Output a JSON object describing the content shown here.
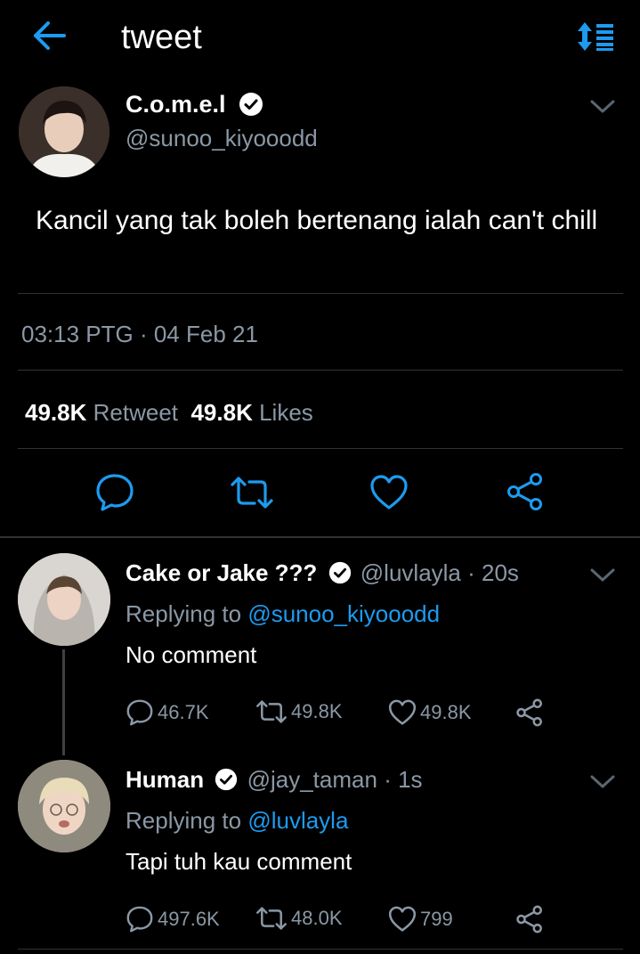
{
  "header": {
    "title": "tweet",
    "back_icon": "arrow-left-icon",
    "sort_icon": "sort-icon",
    "accent": "#1d9bf0"
  },
  "main_tweet": {
    "display_name": "C.o.m.e.l",
    "handle": "@sunoo_kiyooodd",
    "text": "Kancil yang tak boleh bertenang ialah can't chill",
    "timestamp": "03:13 PTG · 04 Feb 21",
    "retweet_count": "49.8K",
    "retweet_label": "Retweet",
    "like_count": "49.8K",
    "like_label": "Likes"
  },
  "replies": [
    {
      "display_name": "Cake or Jake ???",
      "handle": "@luvlayla",
      "time": "· 20s",
      "replying_prefix": "Replying to ",
      "replying_to": "@sunoo_kiyooodd",
      "text": "No comment",
      "reply_count": "46.7K",
      "retweet_count": "49.8K",
      "like_count": "49.8K"
    },
    {
      "display_name": "Human",
      "handle": "@jay_taman",
      "time": "· 1s",
      "replying_prefix": "Replying to ",
      "replying_to": "@luvlayla",
      "text": "Tapi tuh kau comment",
      "reply_count": "497.6K",
      "retweet_count": "48.0K",
      "like_count": "799"
    }
  ],
  "colors": {
    "background": "#000000",
    "secondary_text": "#8b98a5",
    "link": "#1d9bf0",
    "divider": "#2f3336"
  }
}
